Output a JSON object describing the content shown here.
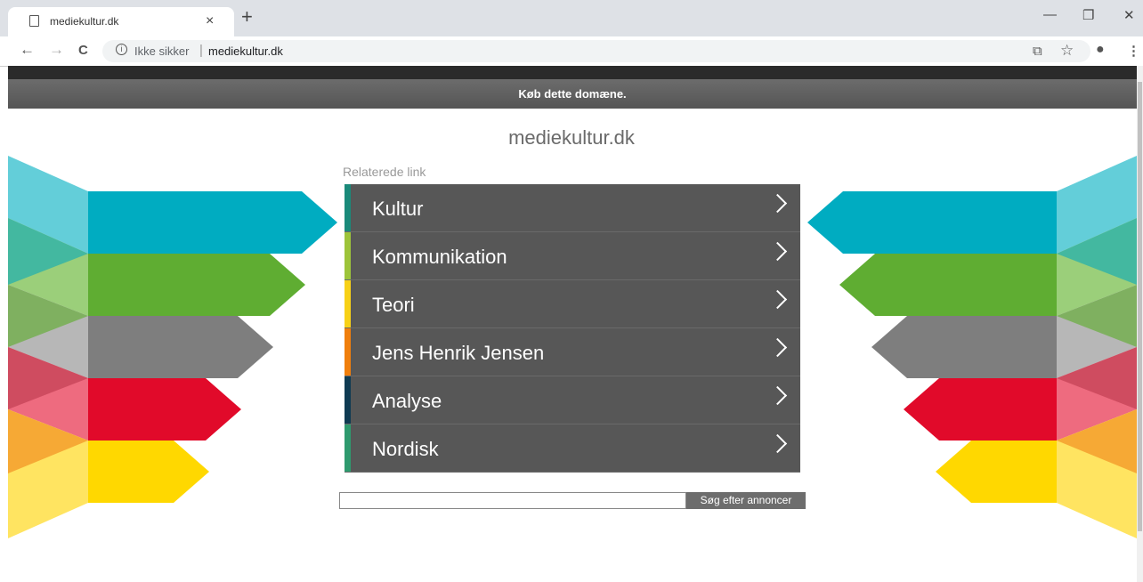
{
  "browser": {
    "tab_title": "mediekultur.dk",
    "tab_close": "×",
    "new_tab": "+",
    "omnibox": {
      "security_text": "Ikke sikker",
      "separator": "|",
      "url": "mediekultur.dk"
    },
    "icons": {
      "back": "←",
      "forward": "→",
      "reload": "C",
      "info": "i",
      "translate": "⧉",
      "star": "☆",
      "account": "●",
      "menu": "⋮",
      "minimize": "—",
      "restore": "❐",
      "close": "✕"
    }
  },
  "page": {
    "buy_banner": "Køb dette domæne.",
    "site_title": "mediekultur.dk",
    "related_label": "Relaterede link",
    "links": [
      {
        "label": "Kultur",
        "accent": "#1a8a7a"
      },
      {
        "label": "Kommunikation",
        "accent": "#9dc43a"
      },
      {
        "label": "Teori",
        "accent": "#f7d117"
      },
      {
        "label": "Jens Henrik Jensen",
        "accent": "#f07f0c"
      },
      {
        "label": "Analyse",
        "accent": "#0f3b52"
      },
      {
        "label": "Nordisk",
        "accent": "#2e9a6e"
      }
    ],
    "search_button": "Søg efter annoncer",
    "arrow_colors": [
      "#00acc1",
      "#5fad32",
      "#7e7e7e",
      "#e10a2a",
      "#ffd800"
    ]
  }
}
